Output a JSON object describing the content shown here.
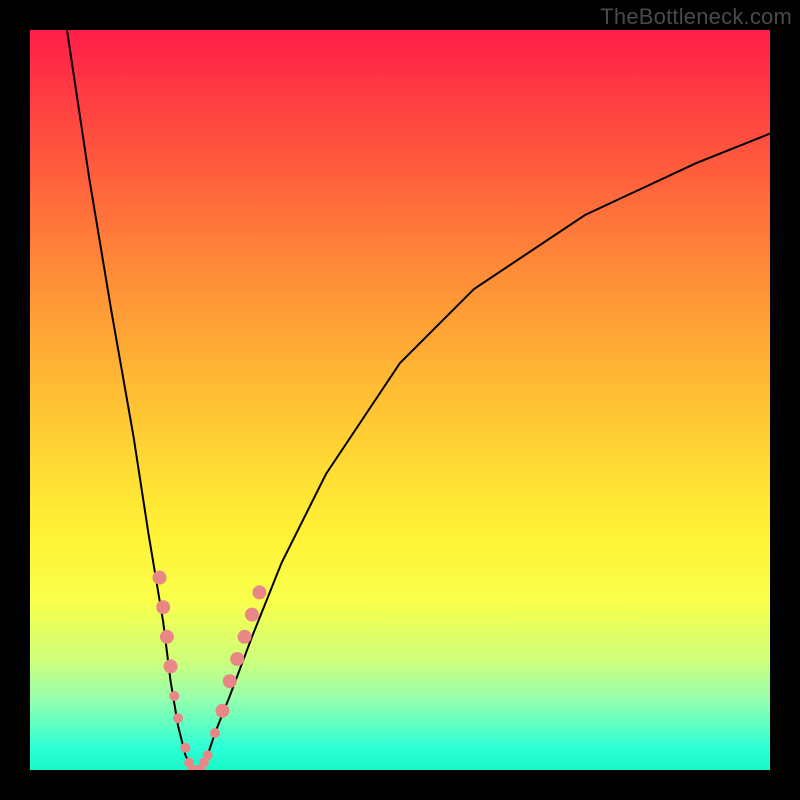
{
  "watermark": "TheBottleneck.com",
  "chart_data": {
    "type": "line",
    "title": "",
    "xlabel": "",
    "ylabel": "",
    "xlim": [
      0,
      100
    ],
    "ylim": [
      0,
      100
    ],
    "grid": false,
    "legend": false,
    "background": "red-yellow-green vertical gradient (bottleneck visual: green low = balanced, red high = bottlenecked)",
    "series": [
      {
        "name": "bottleneck-curve",
        "x": [
          5,
          8,
          11,
          14,
          16,
          18,
          19,
          20,
          21,
          22,
          23,
          24,
          25,
          27,
          30,
          34,
          40,
          50,
          60,
          75,
          90,
          100
        ],
        "y": [
          100,
          80,
          62,
          45,
          32,
          20,
          12,
          6,
          2,
          0,
          0,
          2,
          5,
          10,
          18,
          28,
          40,
          55,
          65,
          75,
          82,
          86
        ],
        "stroke": "#000000",
        "stroke_width": 2
      }
    ],
    "markers": {
      "name": "sample-points",
      "color": "#e98787",
      "radius_small": 5,
      "radius_large": 7,
      "points": [
        {
          "x": 17.5,
          "y": 26
        },
        {
          "x": 18.0,
          "y": 22
        },
        {
          "x": 18.5,
          "y": 18
        },
        {
          "x": 19.0,
          "y": 14
        },
        {
          "x": 19.5,
          "y": 10
        },
        {
          "x": 20.0,
          "y": 7
        },
        {
          "x": 21.0,
          "y": 3
        },
        {
          "x": 21.5,
          "y": 1
        },
        {
          "x": 22.0,
          "y": 0
        },
        {
          "x": 22.5,
          "y": 0
        },
        {
          "x": 23.0,
          "y": 0
        },
        {
          "x": 23.5,
          "y": 1
        },
        {
          "x": 24.0,
          "y": 2
        },
        {
          "x": 25.0,
          "y": 5
        },
        {
          "x": 26.0,
          "y": 8
        },
        {
          "x": 27.0,
          "y": 12
        },
        {
          "x": 28.0,
          "y": 15
        },
        {
          "x": 29.0,
          "y": 18
        },
        {
          "x": 30.0,
          "y": 21
        },
        {
          "x": 31.0,
          "y": 24
        }
      ]
    }
  }
}
